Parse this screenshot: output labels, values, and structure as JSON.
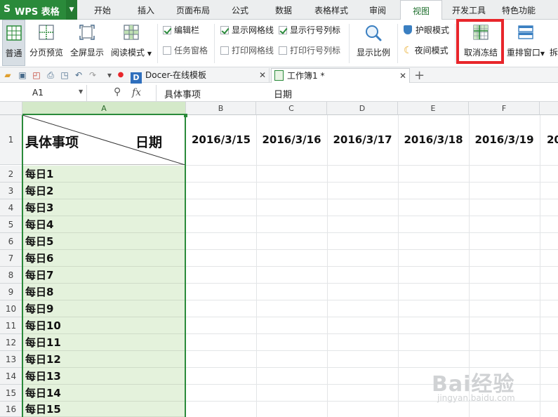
{
  "app": {
    "logo": "WPS 表格"
  },
  "menu": {
    "tabs": [
      "开始",
      "插入",
      "页面布局",
      "公式",
      "数据",
      "表格样式",
      "审阅",
      "视图",
      "开发工具",
      "特色功能"
    ],
    "active_tab": "视图"
  },
  "ribbon": {
    "normal": "普通",
    "page_preview": "分页预览",
    "fullscreen": "全屏显示",
    "reading_mode": "阅读模式",
    "edit_bar": "编辑栏",
    "task_pane": "任务窗格",
    "show_gridlines": "显示网格线",
    "show_headers": "显示行号列标",
    "print_gridlines": "打印网格线",
    "print_headers": "打印行号列标",
    "zoom": "显示比例",
    "eye_mode": "护眼模式",
    "night_mode": "夜间模式",
    "unfreeze": "取消冻结",
    "arrange": "重排窗口",
    "overflow": "拆"
  },
  "tabs_bar": {
    "doc1": "Docer-在线模板",
    "doc2": "工作簿1 *"
  },
  "formula_bar": {
    "cell_ref": "A1",
    "fx": "fx",
    "content_1": "具体事项",
    "content_2": "日期"
  },
  "sheet": {
    "columns": [
      "A",
      "B",
      "C",
      "D",
      "E",
      "F"
    ],
    "header_left": "具体事项",
    "header_right": "日期",
    "dates": [
      "2016/3/15",
      "2016/3/16",
      "2016/3/17",
      "2016/3/18",
      "2016/3/19",
      "20"
    ],
    "row_numbers": [
      "1",
      "2",
      "3",
      "4",
      "5",
      "6",
      "7",
      "8",
      "9",
      "10",
      "11",
      "12",
      "13",
      "14",
      "15",
      "16"
    ],
    "items": [
      "每日1",
      "每日2",
      "每日3",
      "每日4",
      "每日5",
      "每日6",
      "每日7",
      "每日8",
      "每日9",
      "每日10",
      "每日11",
      "每日12",
      "每日13",
      "每日14",
      "每日15"
    ]
  },
  "watermark": {
    "text": "Bai经验",
    "sub": "jingyan.baidu.com"
  },
  "colors": {
    "accent": "#2a8a3a",
    "highlight": "#e8262b",
    "freeze_fill": "#e4f2dc"
  }
}
